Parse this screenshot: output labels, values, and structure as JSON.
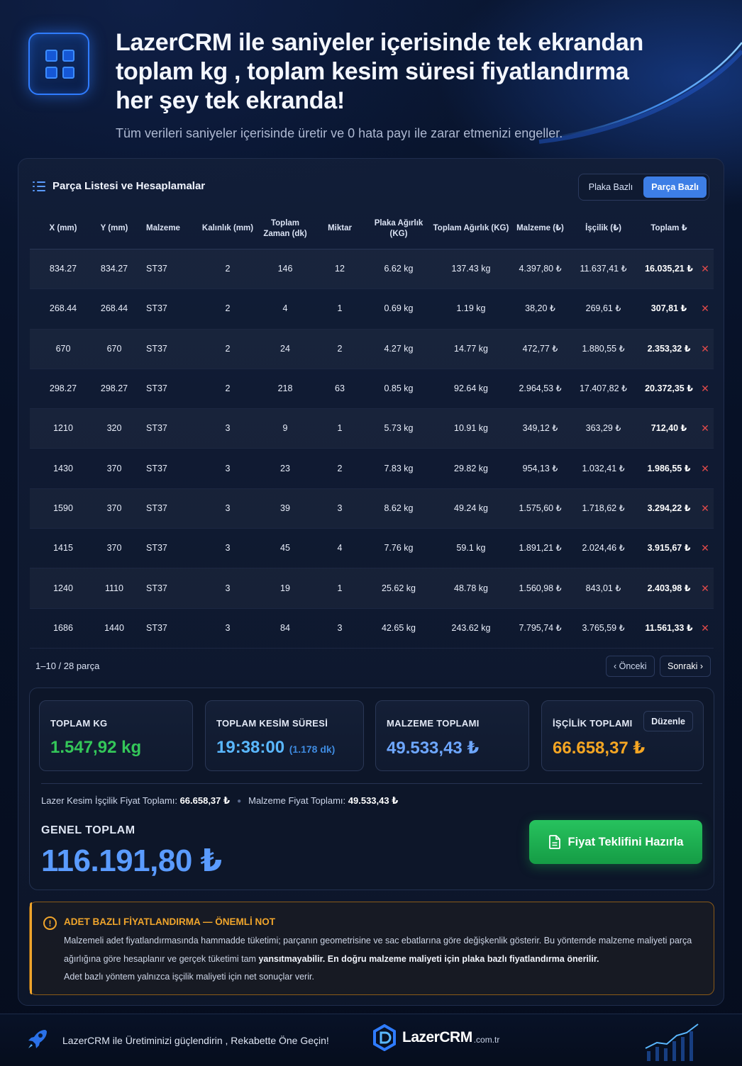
{
  "hero": {
    "title": "LazerCRM ile saniyeler içerisinde tek ekrandan toplam kg , toplam kesim süresi fiyatlandırma her şey tek ekranda!",
    "subtitle": "Tüm verileri saniyeler içerisinde üretir ve 0 hata payı ile zarar etmenizi engeller."
  },
  "panel": {
    "title": "Parça Listesi ve Hesaplamalar",
    "toggle": {
      "option_1": "Plaka Bazlı",
      "option_2": "Parça Bazlı",
      "active": "Parça Bazlı"
    }
  },
  "table": {
    "columns": [
      "X (mm)",
      "Y (mm)",
      "Malzeme",
      "Kalınlık (mm)",
      "Toplam Zaman (dk)",
      "Miktar",
      "Plaka Ağırlık (KG)",
      "Toplam Ağırlık (KG)",
      "Malzeme (₺)",
      "İşçilik (₺)",
      "Toplam ₺"
    ],
    "rows": [
      [
        "834.27",
        "834.27",
        "ST37",
        "2",
        "146",
        "12",
        "6.62 kg",
        "137.43 kg",
        "4.397,80 ₺",
        "11.637,41 ₺",
        "16.035,21 ₺"
      ],
      [
        "268.44",
        "268.44",
        "ST37",
        "2",
        "4",
        "1",
        "0.69 kg",
        "1.19 kg",
        "38,20 ₺",
        "269,61 ₺",
        "307,81 ₺"
      ],
      [
        "670",
        "670",
        "ST37",
        "2",
        "24",
        "2",
        "4.27 kg",
        "14.77 kg",
        "472,77 ₺",
        "1.880,55 ₺",
        "2.353,32 ₺"
      ],
      [
        "298.27",
        "298.27",
        "ST37",
        "2",
        "218",
        "63",
        "0.85 kg",
        "92.64 kg",
        "2.964,53 ₺",
        "17.407,82 ₺",
        "20.372,35 ₺"
      ],
      [
        "1210",
        "320",
        "ST37",
        "3",
        "9",
        "1",
        "5.73 kg",
        "10.91 kg",
        "349,12 ₺",
        "363,29 ₺",
        "712,40 ₺"
      ],
      [
        "1430",
        "370",
        "ST37",
        "3",
        "23",
        "2",
        "7.83 kg",
        "29.82 kg",
        "954,13 ₺",
        "1.032,41 ₺",
        "1.986,55 ₺"
      ],
      [
        "1590",
        "370",
        "ST37",
        "3",
        "39",
        "3",
        "8.62 kg",
        "49.24 kg",
        "1.575,60 ₺",
        "1.718,62 ₺",
        "3.294,22 ₺"
      ],
      [
        "1415",
        "370",
        "ST37",
        "3",
        "45",
        "4",
        "7.76 kg",
        "59.1 kg",
        "1.891,21 ₺",
        "2.024,46 ₺",
        "3.915,67 ₺"
      ],
      [
        "1240",
        "1110",
        "ST37",
        "3",
        "19",
        "1",
        "25.62 kg",
        "48.78 kg",
        "1.560,98 ₺",
        "843,01 ₺",
        "2.403,98 ₺"
      ],
      [
        "1686",
        "1440",
        "ST37",
        "3",
        "84",
        "3",
        "42.65 kg",
        "243.62 kg",
        "7.795,74 ₺",
        "3.765,59 ₺",
        "11.561,33 ₺"
      ]
    ],
    "delete_symbol": "✕"
  },
  "pager": {
    "info": "1–10 / 28 parça",
    "prev": "‹ Önceki",
    "next": "Sonraki ›"
  },
  "summary": {
    "total_kg": {
      "label": "TOPLAM KG",
      "value": "1.547,92 kg",
      "color": "#34c759"
    },
    "cut_time": {
      "label": "TOPLAM KESİM SÜRESİ",
      "value": "19:38:00",
      "note": "(1.178 dk)",
      "color": "#5ab8ff"
    },
    "material": {
      "label": "MALZEME TOPLAMI",
      "value": "49.533,43 ₺",
      "color": "#6ea7ff"
    },
    "labor": {
      "label": "İŞÇİLİK TOPLAMI",
      "value": "66.658,37 ₺",
      "edit": "Düzenle",
      "color": "#f5a623"
    },
    "labor_line_label": "Lazer Kesim İşçilik Fiyat Toplamı:",
    "labor_line_value": "66.658,37 ₺",
    "material_line_label": "Malzeme Fiyat Toplamı:",
    "material_line_value": "49.533,43 ₺",
    "grand_label": "GENEL TOPLAM",
    "grand_value": "116.191,80 ₺",
    "quote_button": "Fiyat Teklifini Hazırla"
  },
  "warning": {
    "title": "ADET BAZLI FİYATLANDIRMA — ÖNEMLİ NOT",
    "text_1": "Malzemeli adet fiyatlandırmasında hammadde tüketimi; parçanın geometrisine ve sac ebatlarına göre değişkenlik gösterir. Bu yöntemde malzeme maliyeti parça ağırlığına göre hesaplanır ve gerçek tüketimi tam",
    "text_bold": "yansıtmayabilir. En doğru malzeme maliyeti için plaka bazlı fiyatlandırma önerilir.",
    "text_2": "Adet bazlı yöntem yalnızca işçilik maliyeti için net sonuçlar verir."
  },
  "footer": {
    "slogan": "LazerCRM ile Üretiminizi güçlendirin , Rekabette Öne Geçin!",
    "logo_name": "LazerCRM",
    "logo_tld": ".com.tr"
  }
}
